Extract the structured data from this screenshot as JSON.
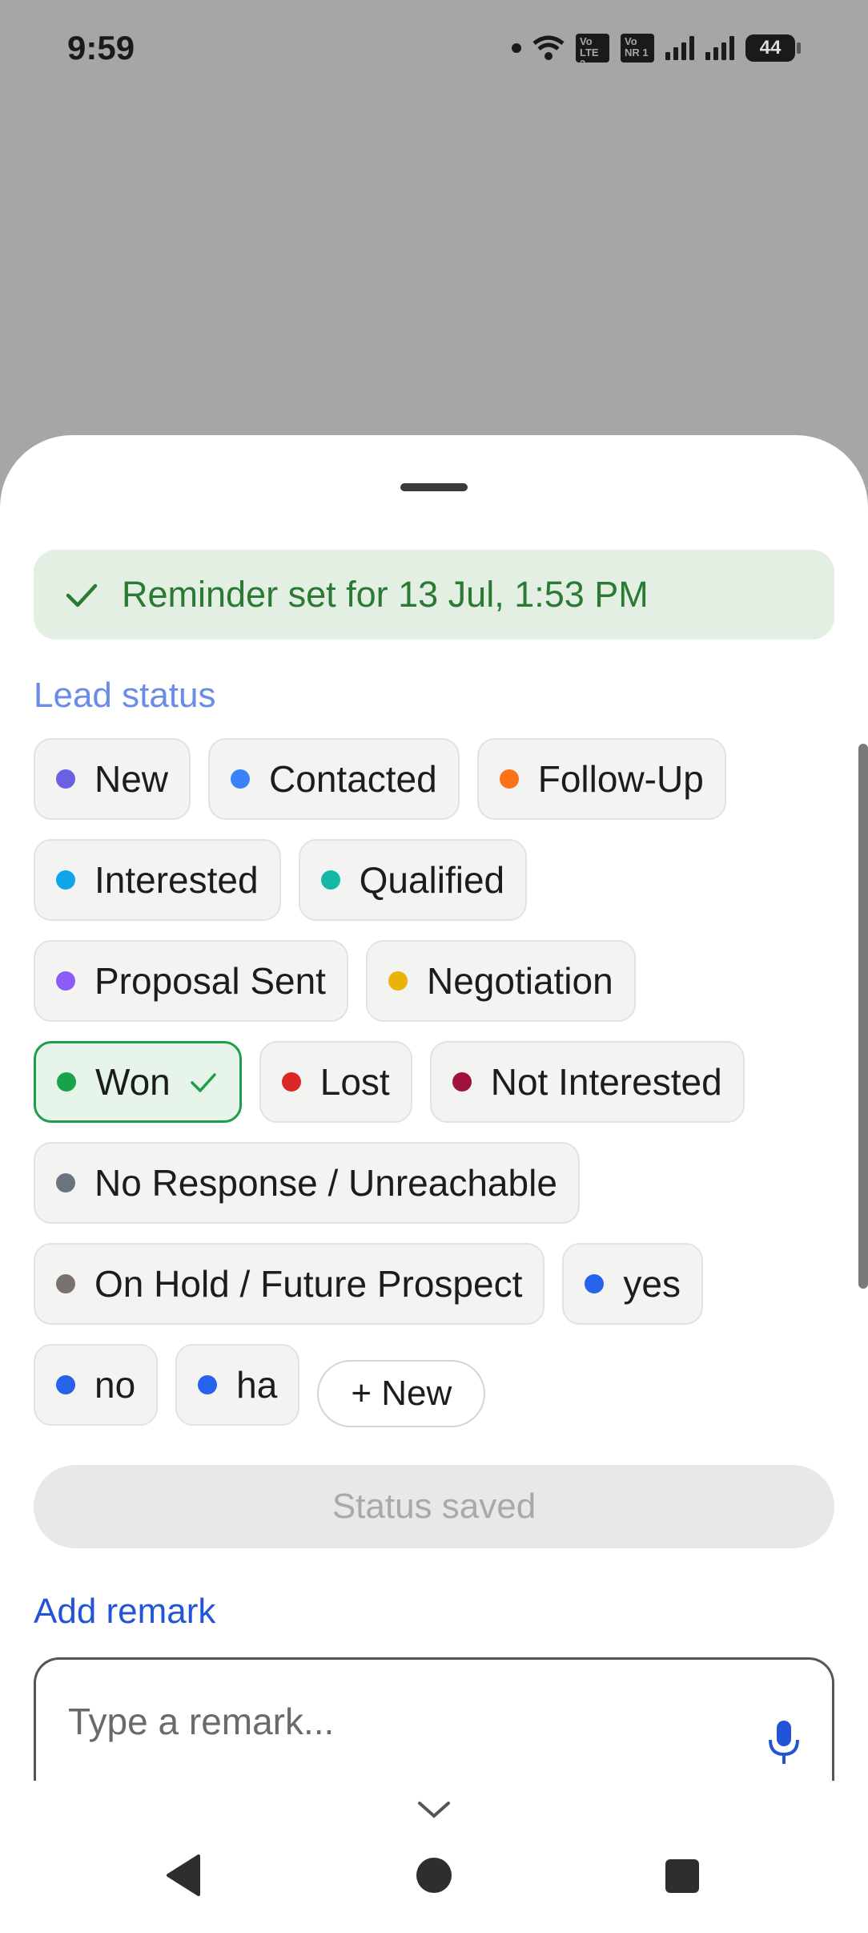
{
  "status_bar": {
    "time": "9:59",
    "sim1": "Vo LTE 2",
    "sim2": "Vo NR 1",
    "battery": "44"
  },
  "reminder": {
    "text": "Reminder set for 13 Jul, 1:53 PM"
  },
  "lead_status": {
    "label": "Lead status",
    "chips": [
      {
        "label": "New",
        "color": "#6b5fe6",
        "selected": false
      },
      {
        "label": "Contacted",
        "color": "#3b82f6",
        "selected": false
      },
      {
        "label": "Follow-Up",
        "color": "#f97316",
        "selected": false
      },
      {
        "label": "Interested",
        "color": "#0ea5e9",
        "selected": false
      },
      {
        "label": "Qualified",
        "color": "#14b8a6",
        "selected": false
      },
      {
        "label": "Proposal Sent",
        "color": "#8b5cf6",
        "selected": false
      },
      {
        "label": "Negotiation",
        "color": "#eab308",
        "selected": false
      },
      {
        "label": "Won",
        "color": "#16a34a",
        "selected": true
      },
      {
        "label": "Lost",
        "color": "#dc2626",
        "selected": false
      },
      {
        "label": "Not Interested",
        "color": "#9f1239",
        "selected": false
      },
      {
        "label": "No Response / Unreachable",
        "color": "#6b7280",
        "selected": false
      },
      {
        "label": "On Hold / Future Prospect",
        "color": "#78716c",
        "selected": false
      },
      {
        "label": "yes",
        "color": "#2563eb",
        "selected": false
      },
      {
        "label": "no",
        "color": "#2563eb",
        "selected": false
      },
      {
        "label": "ha",
        "color": "#2563eb",
        "selected": false
      }
    ],
    "add_new_label": "+ New"
  },
  "save_button": {
    "label": "Status saved"
  },
  "remark": {
    "label": "Add remark",
    "placeholder": "Type a remark..."
  },
  "colors": {
    "accent": "#2255d6",
    "success": "#2a7a34"
  }
}
